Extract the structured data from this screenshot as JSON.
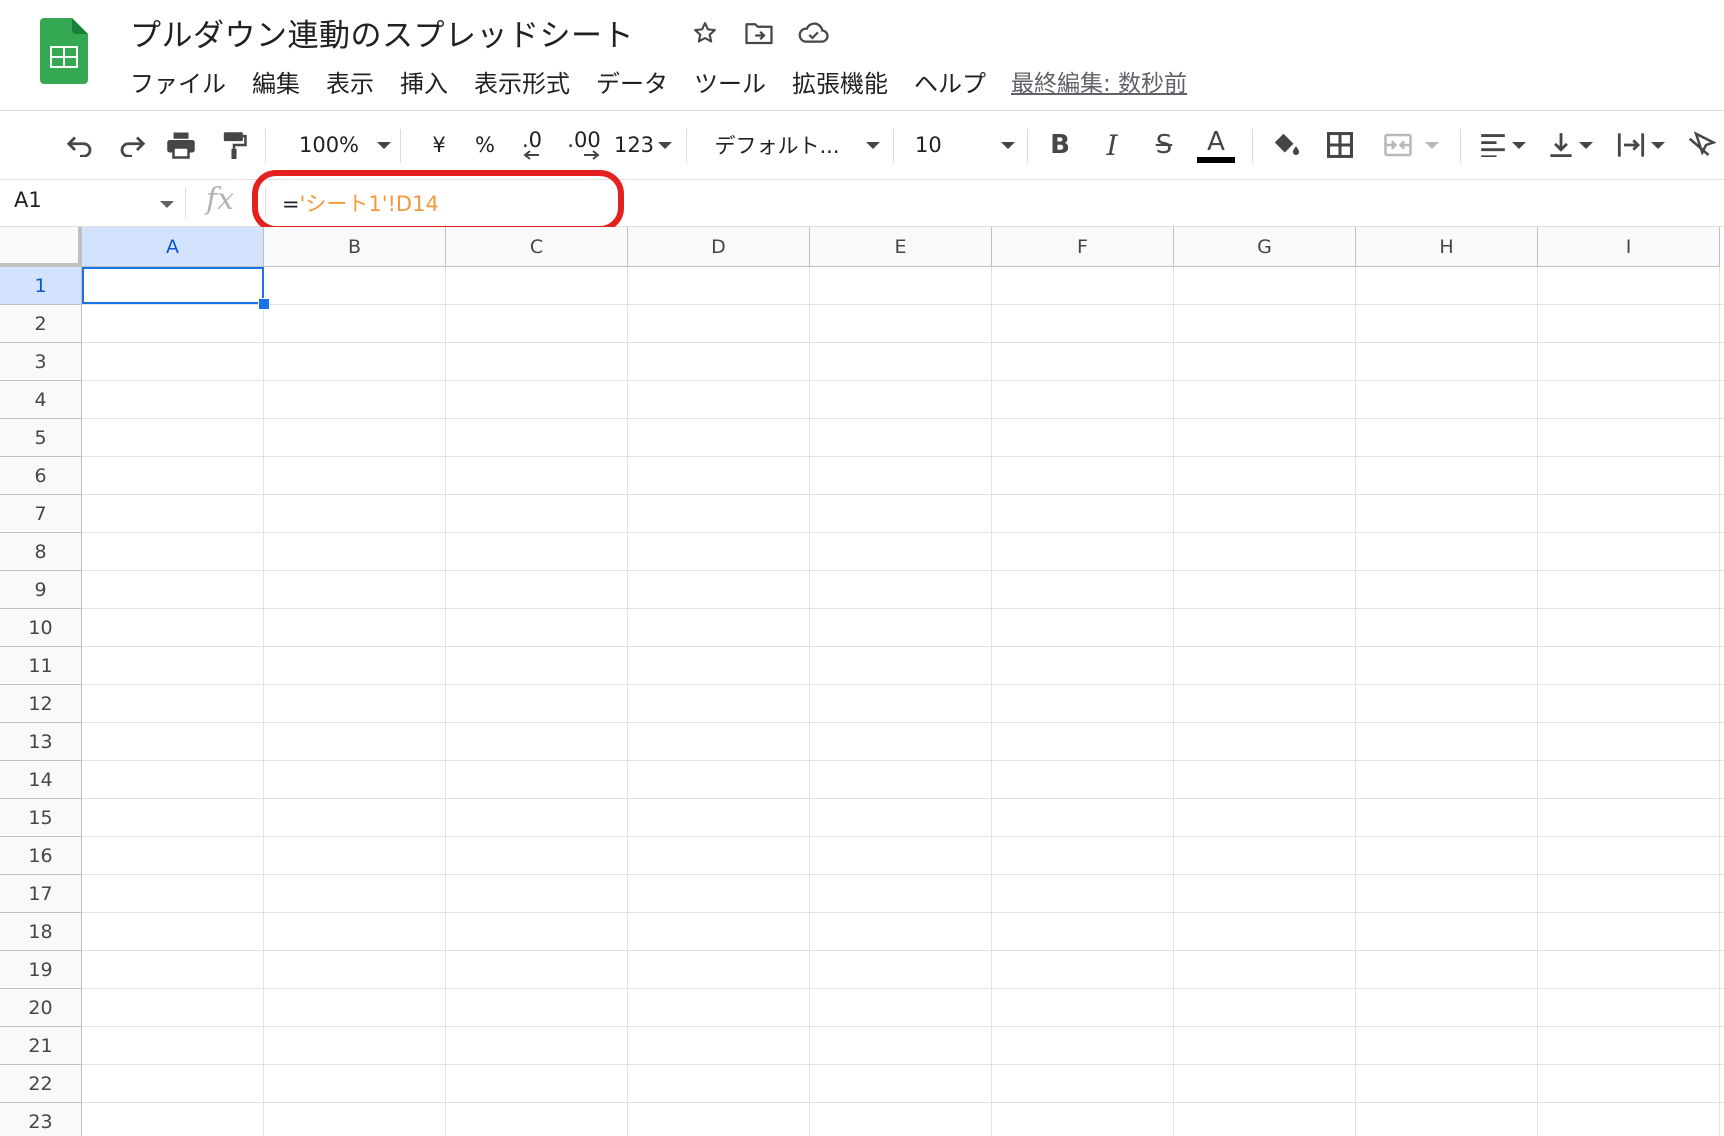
{
  "document": {
    "title": "プルダウン連動のスプレッドシート"
  },
  "menu": {
    "items": [
      "ファイル",
      "編集",
      "表示",
      "挿入",
      "表示形式",
      "データ",
      "ツール",
      "拡張機能",
      "ヘルプ"
    ],
    "last_edit": "最終編集: 数秒前"
  },
  "toolbar": {
    "zoom": "100%",
    "currency": "¥",
    "percent": "%",
    "decrease_decimal": ".0",
    "increase_decimal": ".00",
    "number_format": "123",
    "font": "デフォルト...",
    "font_size": "10",
    "bold": "B",
    "italic": "I",
    "strikethrough": "S",
    "text_color_letter": "A"
  },
  "formula_bar": {
    "name_box": "A1",
    "fx": "fx",
    "formula_eq": "=",
    "formula_ref": "'シート1'!D14"
  },
  "grid": {
    "columns": [
      "A",
      "B",
      "C",
      "D",
      "E",
      "F",
      "G",
      "H",
      "I"
    ],
    "rows": [
      "1",
      "2",
      "3",
      "4",
      "5",
      "6",
      "7",
      "8",
      "9",
      "10",
      "11",
      "12",
      "13",
      "14",
      "15",
      "16",
      "17",
      "18",
      "19",
      "20",
      "21",
      "22",
      "23"
    ],
    "selected_cell": "A1"
  },
  "colors": {
    "accent": "#1a73e8",
    "highlight": "#e3211e",
    "formula_reference": "#f29a3a",
    "sheets_green": "#0f9d58"
  }
}
